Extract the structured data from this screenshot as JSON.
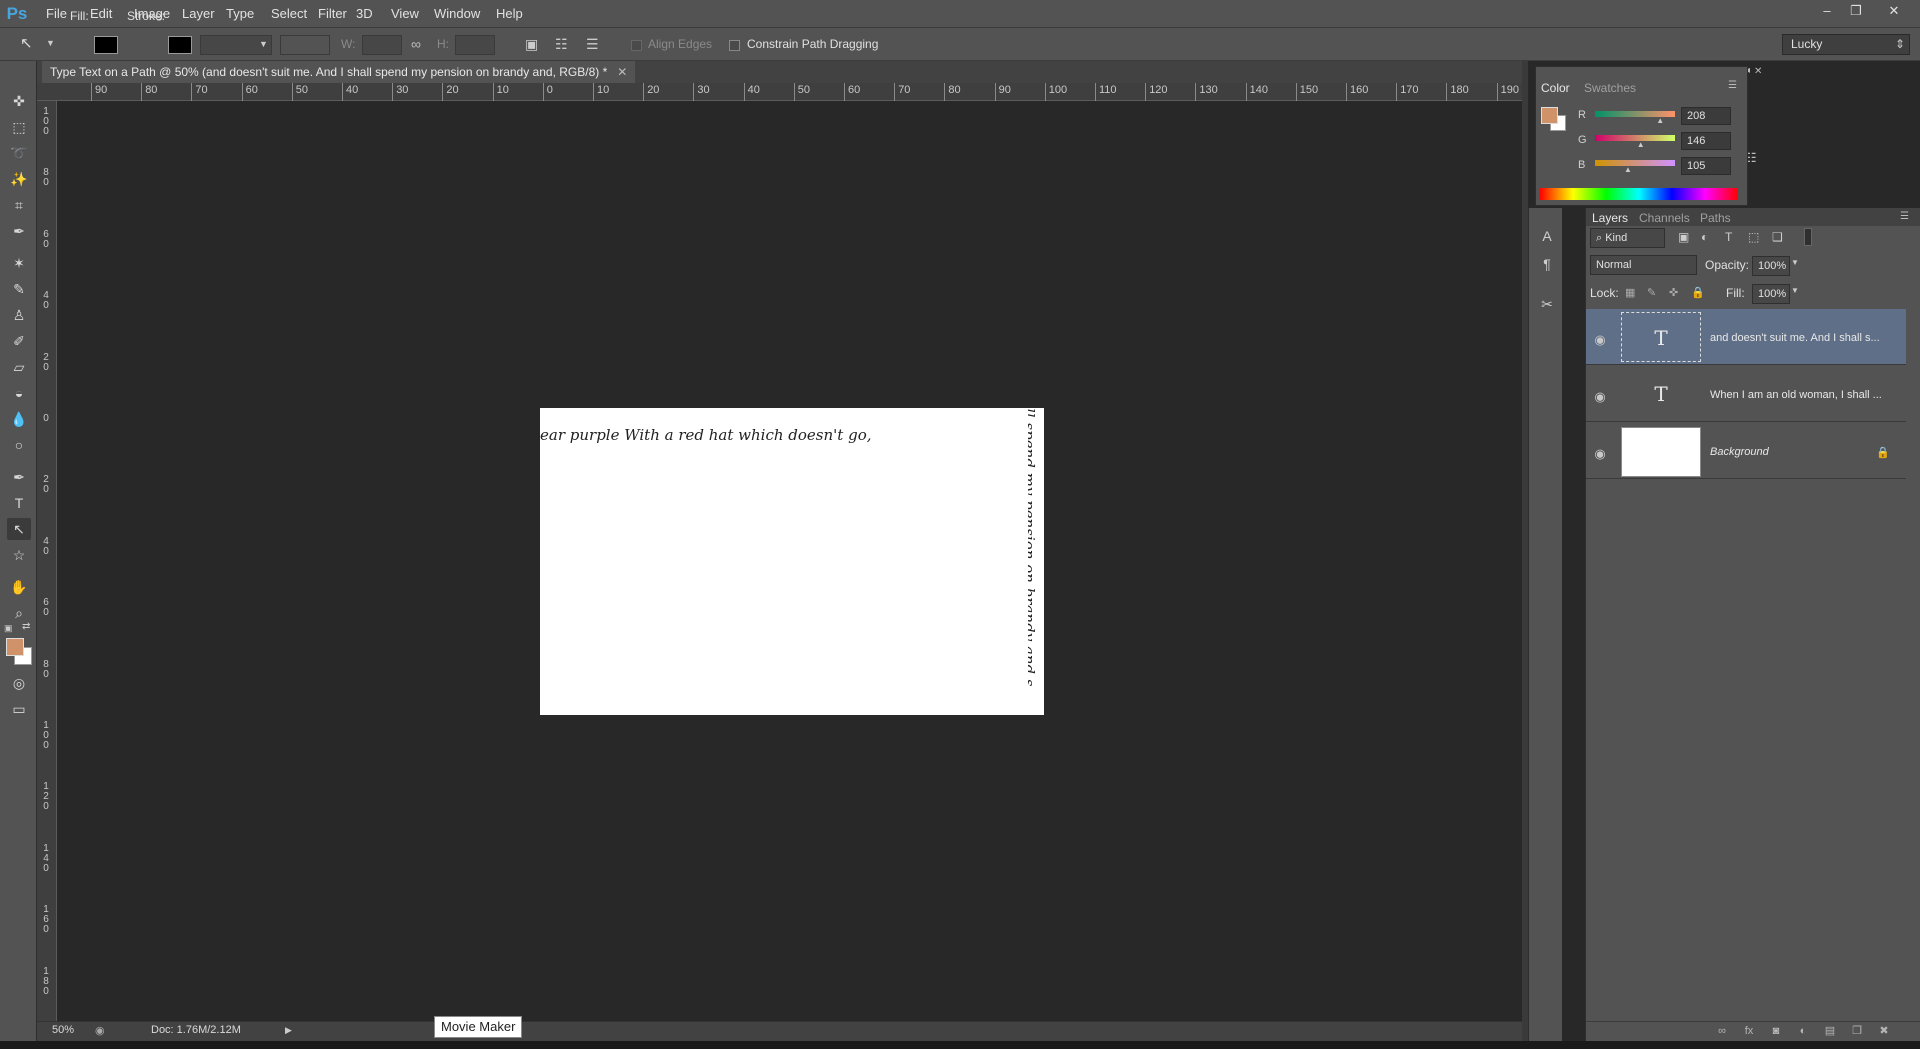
{
  "app": {
    "logo": "Ps"
  },
  "menu": [
    "File",
    "Edit",
    "Image",
    "Layer",
    "Type",
    "Select",
    "Filter",
    "3D",
    "View",
    "Window",
    "Help"
  ],
  "options_bar": {
    "fill_label": "Fill:",
    "stroke_label": "Stroke:",
    "w_label": "W:",
    "h_label": "H:",
    "align_edges": "Align Edges",
    "constrain": "Constrain Path Dragging",
    "workspace": "Lucky"
  },
  "document": {
    "tab_title": "Type Text on a Path @ 50% (and doesn't suit me. And I shall spend my pension on brandy and, RGB/8) *",
    "path_text_horizontal": "ear purple With a red hat which doesn't go,",
    "path_text_vertical": "ll spend my pension on brandy and s"
  },
  "ruler": {
    "top_labels": [
      "90",
      "80",
      "70",
      "60",
      "50",
      "40",
      "30",
      "20",
      "10",
      "0",
      "10",
      "20",
      "30",
      "40",
      "50",
      "60",
      "70",
      "80",
      "90",
      "100",
      "110",
      "120",
      "130",
      "140",
      "150",
      "160",
      "170",
      "180",
      "190"
    ],
    "left_labels": [
      "1 0 0",
      "8 0",
      "6 0",
      "4 0",
      "2 0",
      "0",
      "2 0",
      "4 0",
      "6 0",
      "8 0",
      "1 0 0",
      "1 2 0",
      "1 4 0",
      "1 6 0",
      "1 8 0"
    ]
  },
  "status": {
    "zoom": "50%",
    "doc": "Doc: 1.76M/2.12M"
  },
  "taskbar_tooltip": "Movie Maker",
  "color_panel": {
    "tabs": [
      "Color",
      "Swatches"
    ],
    "r_label": "R",
    "g_label": "G",
    "b_label": "B",
    "r": "208",
    "g": "146",
    "b": "105",
    "fg_color": "#d09269"
  },
  "layers_panel": {
    "tabs": [
      "Layers",
      "Channels",
      "Paths"
    ],
    "kind": "Kind",
    "blend": "Normal",
    "opacity_label": "Opacity:",
    "opacity": "100%",
    "lock_label": "Lock:",
    "fill_label": "Fill:",
    "fill": "100%",
    "layers": [
      {
        "name": "and doesn't suit me. And I shall s...",
        "type": "text",
        "selected": true
      },
      {
        "name": "When I am an old woman, I shall ...",
        "type": "text",
        "selected": false
      },
      {
        "name": "Background",
        "type": "image",
        "selected": false
      }
    ],
    "thumb_glyph": "T"
  },
  "icons": {
    "window_controls": [
      "minimize-icon",
      "restore-icon",
      "close-icon"
    ]
  }
}
